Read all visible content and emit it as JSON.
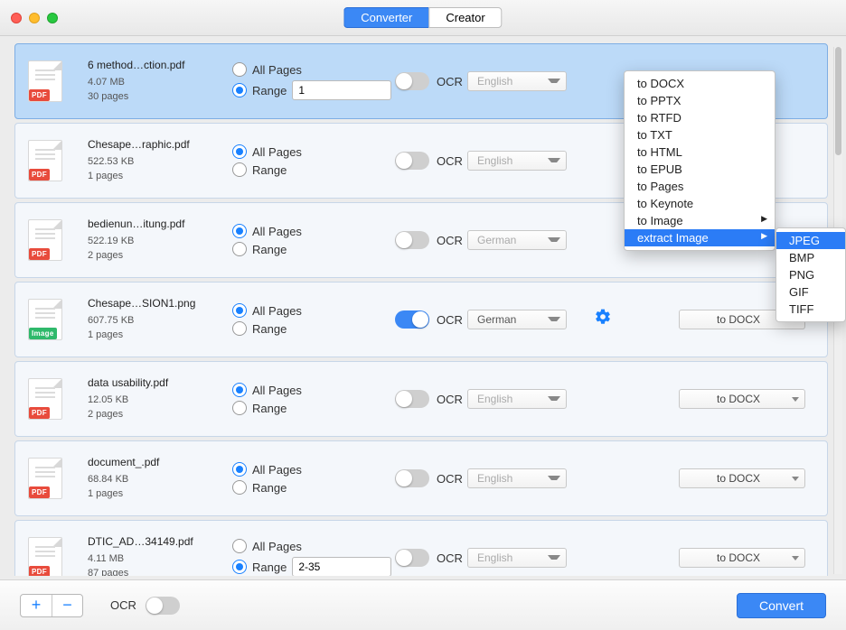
{
  "tabs": {
    "converter": "Converter",
    "creator": "Creator"
  },
  "labels": {
    "all_pages": "All Pages",
    "range": "Range",
    "ocr": "OCR",
    "convert": "Convert"
  },
  "files": [
    {
      "name": "6 method…ction.pdf",
      "size": "4.07 MB",
      "pages": "30 pages",
      "type": "PDF",
      "pagesMode": "range",
      "rangeValue": "1",
      "ocr": false,
      "lang": "English",
      "langDisabled": true,
      "fmt": "",
      "selected": true,
      "gear": false
    },
    {
      "name": "Chesape…raphic.pdf",
      "size": "522.53 KB",
      "pages": "1 pages",
      "type": "PDF",
      "pagesMode": "all",
      "rangeValue": "",
      "ocr": false,
      "lang": "English",
      "langDisabled": true,
      "fmt": "",
      "selected": false,
      "gear": false
    },
    {
      "name": "bedienun…itung.pdf",
      "size": "522.19 KB",
      "pages": "2 pages",
      "type": "PDF",
      "pagesMode": "all",
      "rangeValue": "",
      "ocr": false,
      "lang": "German",
      "langDisabled": true,
      "fmt": "",
      "selected": false,
      "gear": false
    },
    {
      "name": "Chesape…SION1.png",
      "size": "607.75 KB",
      "pages": "1 pages",
      "type": "Image",
      "pagesMode": "all",
      "rangeValue": "",
      "ocr": true,
      "lang": "German",
      "langDisabled": false,
      "fmt": "to DOCX",
      "selected": false,
      "gear": true
    },
    {
      "name": "data usability.pdf",
      "size": "12.05 KB",
      "pages": "2 pages",
      "type": "PDF",
      "pagesMode": "all",
      "rangeValue": "",
      "ocr": false,
      "lang": "English",
      "langDisabled": true,
      "fmt": "to DOCX",
      "selected": false,
      "gear": false
    },
    {
      "name": "document_.pdf",
      "size": "68.84 KB",
      "pages": "1 pages",
      "type": "PDF",
      "pagesMode": "all",
      "rangeValue": "",
      "ocr": false,
      "lang": "English",
      "langDisabled": true,
      "fmt": "to DOCX",
      "selected": false,
      "gear": false
    },
    {
      "name": "DTIC_AD…34149.pdf",
      "size": "4.11 MB",
      "pages": "87 pages",
      "type": "PDF",
      "pagesMode": "range",
      "rangeValue": "2-35",
      "ocr": false,
      "lang": "English",
      "langDisabled": true,
      "fmt": "to DOCX",
      "selected": false,
      "gear": false
    }
  ],
  "format_menu": {
    "items": [
      "to DOCX",
      "to PPTX",
      "to RTFD",
      "to TXT",
      "to HTML",
      "to EPUB",
      "to Pages",
      "to Keynote",
      "to Image",
      "extract Image"
    ],
    "highlighted": "extract Image",
    "submenu_for": [
      "to Image",
      "extract Image"
    ],
    "submenu": [
      "JPEG",
      "BMP",
      "PNG",
      "GIF",
      "TIFF"
    ],
    "submenu_highlighted": "JPEG"
  },
  "footer": {
    "ocr_global": false
  }
}
